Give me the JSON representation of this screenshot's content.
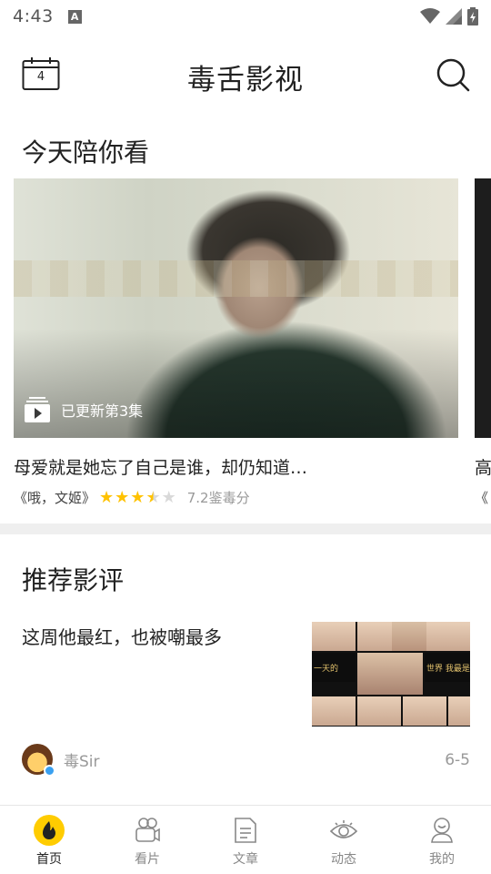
{
  "status_bar": {
    "time": "4:43",
    "notification_letter": "A"
  },
  "header": {
    "calendar_day": "4",
    "logo_text": "毒舌影视"
  },
  "today": {
    "section_title": "今天陪你看",
    "cards": [
      {
        "badge": "已更新第3集",
        "caption": "母爱就是她忘了自己是谁，却仍知道…",
        "show_title": "《哦，文姬》",
        "rating_stars": 3.5,
        "score_text": "7.2鉴毒分"
      },
      {
        "caption": "高",
        "show_title": "《"
      }
    ]
  },
  "review": {
    "section_title": "推荐影评",
    "title": "这周他最红，也被嘲最多",
    "thumb_captions": [
      "一天的",
      "世界 我最是"
    ],
    "author": "毒Sir",
    "date": "6-5"
  },
  "tabbar": {
    "items": [
      {
        "label": "首页",
        "icon": "home-icon",
        "active": true
      },
      {
        "label": "看片",
        "icon": "film-icon",
        "active": false
      },
      {
        "label": "文章",
        "icon": "article-icon",
        "active": false
      },
      {
        "label": "动态",
        "icon": "eye-icon",
        "active": false
      },
      {
        "label": "我的",
        "icon": "profile-icon",
        "active": false
      }
    ]
  },
  "colors": {
    "accent": "#ffcc00",
    "star_filled": "#ffc200",
    "star_empty": "#d9d9d9",
    "muted_text": "#999999"
  }
}
